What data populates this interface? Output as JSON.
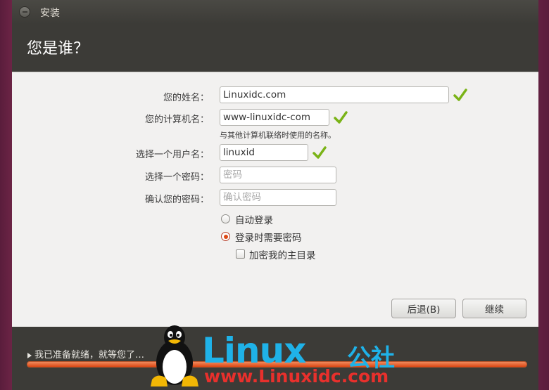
{
  "window": {
    "title": "安装"
  },
  "page": {
    "title": "您是谁？"
  },
  "form": {
    "name": {
      "label": "您的姓名：",
      "value": "Linuxidc.com",
      "valid": true
    },
    "computer": {
      "label": "您的计算机名：",
      "value": "www-linuxidc-com",
      "valid": true,
      "hint": "与其他计算机联络时使用的名称。"
    },
    "username": {
      "label": "选择一个用户名：",
      "value": "linuxid",
      "valid": true
    },
    "password": {
      "label": "选择一个密码：",
      "value": "",
      "placeholder": "密码"
    },
    "confirm": {
      "label": "确认您的密码：",
      "value": "",
      "placeholder": "确认密码"
    },
    "login_options": [
      {
        "label": "自动登录",
        "selected": false
      },
      {
        "label": "登录时需要密码",
        "selected": true
      }
    ],
    "encrypt_home": {
      "label": "加密我的主目录",
      "checked": false
    }
  },
  "buttons": {
    "back": "后退(B)",
    "continue": "继续"
  },
  "footer": {
    "status": "我已准备就绪，就等您了…",
    "progress": 1.0
  },
  "watermark": {
    "brand": "Linux",
    "brand_cn": "公社",
    "url": "www.Linuxidc.com"
  },
  "colors": {
    "accent": "#dd4814",
    "check": "#7ab317",
    "watermark_blue": "#1fb2e8",
    "watermark_red": "#e8302c"
  }
}
